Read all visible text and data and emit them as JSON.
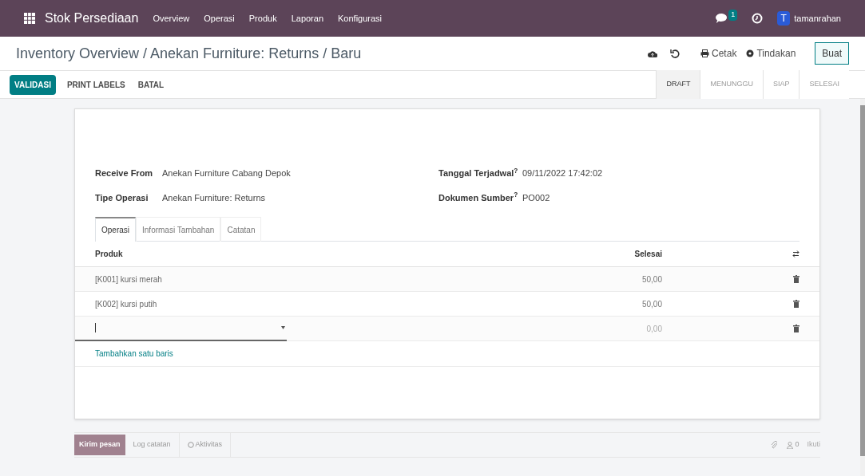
{
  "navbar": {
    "app_name": "Stok Persediaan",
    "menu": [
      "Overview",
      "Operasi",
      "Produk",
      "Laporan",
      "Konfigurasi"
    ],
    "message_count": "1",
    "avatar_letter": "T",
    "user": "tamanrahan"
  },
  "breadcrumb": "Inventory Overview / Anekan Furniture: Returns / Baru",
  "control_actions": {
    "print": "Cetak",
    "action": "Tindakan",
    "create": "Buat"
  },
  "buttons": [
    {
      "label": "VALIDASI",
      "kind": "primary"
    },
    {
      "label": "PRINT LABELS",
      "kind": "plain"
    },
    {
      "label": "BATAL",
      "kind": "plain"
    }
  ],
  "status_stages": [
    {
      "label": "DRAFT",
      "selected": true
    },
    {
      "label": "MENUNGGU",
      "selected": false
    },
    {
      "label": "SIAP",
      "selected": false
    },
    {
      "label": "SELESAI",
      "selected": false
    }
  ],
  "fields_left": [
    {
      "label": "Receive From",
      "value": "Anekan Furniture Cabang Depok"
    },
    {
      "label": "Tipe Operasi",
      "value": "Anekan Furniture: Returns"
    }
  ],
  "fields_right": [
    {
      "label": "Tanggal Terjadwal$^{?}$",
      "value": "09/11/2022 17:42:02"
    },
    {
      "label": "Dokumen Sumber$^{?}$",
      "value": "PO002"
    }
  ],
  "tabs": [
    {
      "label": "Operasi",
      "selected": true
    },
    {
      "label": "Informasi Tambahan",
      "selected": false
    },
    {
      "label": "Catatan",
      "selected": false
    }
  ],
  "table": {
    "columns": [
      "Produk",
      "Selesai"
    ],
    "rows": [
      {
        "product": "[K001] kursi merah",
        "done": "50,00",
        "editing": false
      },
      {
        "product": "[K002] kursi putih",
        "done": "50,00",
        "editing": false
      },
      {
        "done": "0,00",
        "editing": true
      }
    ],
    "add_line": "Tambahkan satu baris"
  },
  "chatter": {
    "send": "Kirim pesan",
    "log": "Log catatan",
    "activity": "Aktivitas",
    "followers": "0",
    "follow": "Ikuti"
  }
}
